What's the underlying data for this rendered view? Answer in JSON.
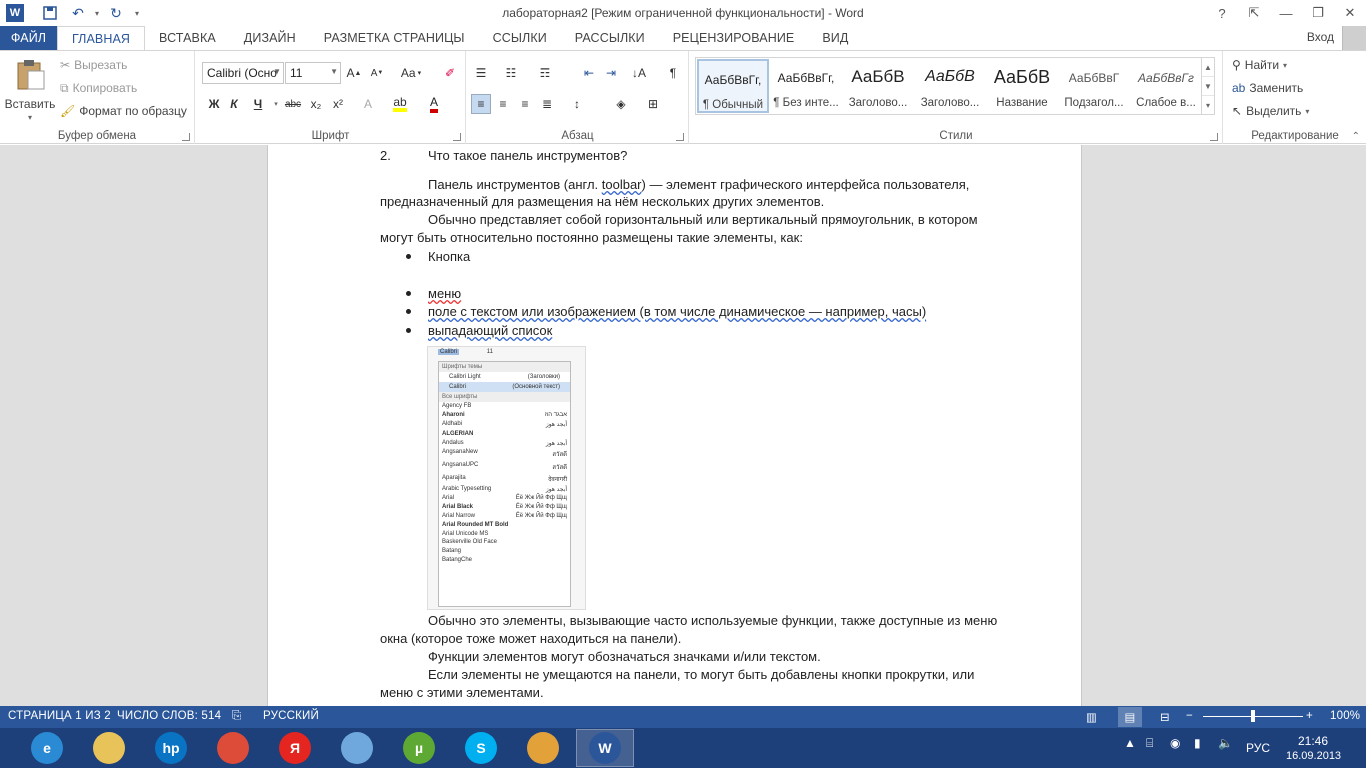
{
  "app": {
    "title": "лабораторная2 [Режим ограниченной функциональности] - Word",
    "logo": "W",
    "colors": {
      "accent": "#2b579a",
      "statusbar": "#2b579a",
      "taskbar": "#1d3f7a"
    },
    "qat": {
      "save": "save-icon",
      "undo": "undo-icon",
      "redo": "redo-icon"
    },
    "window_controls": {
      "help": "?",
      "restore": "❐",
      "minimize": "—",
      "maximize": "❐",
      "close": "✕"
    }
  },
  "tabs": [
    "ФАЙЛ",
    "ГЛАВНАЯ",
    "ВСТАВКА",
    "ДИЗАЙН",
    "РАЗМЕТКА СТРАНИЦЫ",
    "ССЫЛКИ",
    "РАССЫЛКИ",
    "РЕЦЕНЗИРОВАНИЕ",
    "ВИД"
  ],
  "signin": "Вход",
  "ribbon": {
    "clipboard": {
      "paste": "Вставить",
      "cut": "Вырезать",
      "copy": "Копировать",
      "format_painter": "Формат по образцу",
      "label": "Буфер обмена"
    },
    "font": {
      "name": "Calibri (Осно",
      "size": "11",
      "label": "Шрифт",
      "case": "Aa",
      "bold": "Ж",
      "italic": "К",
      "underline": "Ч",
      "strike": "abc",
      "sub": "x₂",
      "sup": "x²"
    },
    "paragraph": {
      "label": "Абзац"
    },
    "styles": {
      "label": "Стили",
      "items": [
        {
          "sample": "АаБбВвГг,",
          "name": "¶ Обычный"
        },
        {
          "sample": "АаБбВвГг,",
          "name": "¶ Без инте..."
        },
        {
          "sample": "АаБбВ",
          "name": "Заголово..."
        },
        {
          "sample": "АаБбВ",
          "name": "Заголово..."
        },
        {
          "sample": "АаБбВ",
          "name": "Название"
        },
        {
          "sample": "АаБбВвГ",
          "name": "Подзагол..."
        },
        {
          "sample": "АаБбВвГг",
          "name": "Слабое в..."
        }
      ]
    },
    "editing": {
      "find": "Найти",
      "replace": "Заменить",
      "select": "Выделить",
      "label": "Редактирование"
    }
  },
  "document": {
    "heading_num": "2.",
    "heading": "Что такое панель инструментов?",
    "p1a": "Панель инструментов (англ. ",
    "p1b": "toolbar",
    "p1c": ") — элемент графического интерфейса пользователя,",
    "p1d": "предназначенный для размещения на нём нескольких других элементов.",
    "p2a": "Обычно представляет собой горизонтальный или вертикальный прямоугольник, в котором",
    "p2b": "могут быть относительно постоянно размещены такие элементы, как:",
    "bullets": [
      "Кнопка",
      "меню",
      "поле с текстом или изображением (в том числе динамическое — например, часы)",
      "выпадающий список"
    ],
    "p3a": "Обычно это элементы, вызывающие часто используемые функции, также доступные из меню",
    "p3b": "окна (которое тоже может находиться на панели).",
    "p4": "Функции элементов могут обозначаться значками и/или текстом.",
    "p5a": "Если элементы не умещаются на панели, то могут быть добавлены кнопки прокрутки, или",
    "p5b": "меню с этими элементами."
  },
  "embedded": {
    "font": "Calibri",
    "size": "11",
    "theme_header": "Шрифты темы",
    "theme_fonts": [
      {
        "name": "Calibri Light",
        "tag": "(Заголовки)"
      },
      {
        "name": "Calibri",
        "tag": "(Основной текст)"
      }
    ],
    "all_header": "Все шрифты",
    "fonts": [
      {
        "name": "Agency FB",
        "sample": ""
      },
      {
        "name": "Aharoni",
        "sample": "אבגד הוז"
      },
      {
        "name": "Aldhabi",
        "sample": "أبجد هوز"
      },
      {
        "name": "ALGERIAN",
        "sample": ""
      },
      {
        "name": "Andalus",
        "sample": "أبجد هوز"
      },
      {
        "name": "AngsanaNew",
        "sample": "สวัสดี"
      },
      {
        "name": "AngsanaUPC",
        "sample": "สวัสดี"
      },
      {
        "name": "Aparajita",
        "sample": "देवनागरी"
      },
      {
        "name": "Arabic Typesetting",
        "sample": "أبجد هوز"
      },
      {
        "name": "Arial",
        "sample": "Ёё Жж Йй Фф Щщ"
      },
      {
        "name": "Arial Black",
        "sample": "Ёё Жж Йй Фф Щщ"
      },
      {
        "name": "Arial Narrow",
        "sample": "Ёё Жж Йй Фф Щщ"
      },
      {
        "name": "Arial Rounded MT Bold",
        "sample": ""
      },
      {
        "name": "Arial Unicode MS",
        "sample": ""
      },
      {
        "name": "Baskerville Old Face",
        "sample": ""
      },
      {
        "name": "Batang",
        "sample": ""
      },
      {
        "name": "BatangChe",
        "sample": ""
      }
    ]
  },
  "status": {
    "page": "СТРАНИЦА 1 ИЗ 2",
    "words": "ЧИСЛО СЛОВ: 514",
    "lang": "РУССКИЙ",
    "zoom": "100%",
    "zoom_level": 0.5
  },
  "taskbar": {
    "apps": [
      {
        "name": "ie",
        "label": "e",
        "color": "#2a8ad4"
      },
      {
        "name": "explorer",
        "label": "",
        "color": "#e8c35a"
      },
      {
        "name": "hp",
        "label": "hp",
        "color": "#0a74c4"
      },
      {
        "name": "chrome",
        "label": "",
        "color": "#dd4b39"
      },
      {
        "name": "yandex",
        "label": "Я",
        "color": "#e52620"
      },
      {
        "name": "speaker",
        "label": "",
        "color": "#6fa8dc"
      },
      {
        "name": "utorrent",
        "label": "µ",
        "color": "#5ea934"
      },
      {
        "name": "skype",
        "label": "S",
        "color": "#00aff0"
      },
      {
        "name": "paint",
        "label": "",
        "color": "#e3a13a"
      },
      {
        "name": "word",
        "label": "W",
        "color": "#2b579a"
      }
    ],
    "lang": "РУС",
    "time": "21:46",
    "date": "16.09.2013"
  }
}
